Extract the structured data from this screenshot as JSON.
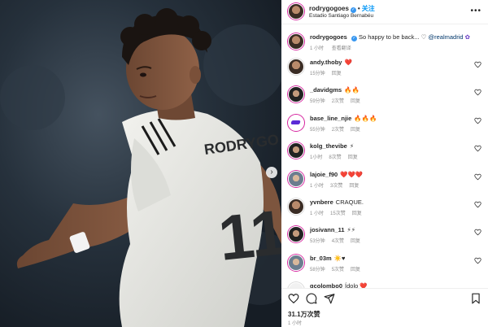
{
  "post": {
    "username": "rodrygogoes",
    "follow_label": "关注",
    "location": "Estadio Santiago Bernabéu",
    "caption_username": "rodrygogoes",
    "caption_text": "So happy to be back...",
    "caption_heart": "♡",
    "caption_mention": "@realmadrid",
    "caption_time": "1 小时",
    "caption_translate": "查看翻译",
    "jersey_number": "11",
    "jersey_name": "RODRYGO"
  },
  "comments": [
    {
      "user": "andy.thoby",
      "text": "❤️",
      "time": "15分钟",
      "likes": "",
      "reply": "回复",
      "avatar": "plain"
    },
    {
      "user": "_davidgms",
      "text": "🔥🔥",
      "time": "59分钟",
      "likes": "2次赞",
      "reply": "回复",
      "avatar": "dark"
    },
    {
      "user": "base_line_njie",
      "text": "🔥🔥🔥",
      "time": "55分钟",
      "likes": "2次赞",
      "reply": "回复",
      "avatar": "logo"
    },
    {
      "user": "kolg_thevibe",
      "text": "⚡",
      "time": "1小时",
      "likes": "8次赞",
      "reply": "回复",
      "avatar": "dark"
    },
    {
      "user": "lajoie_f90",
      "text": "❤️❤️❤️",
      "time": "1 小时",
      "likes": "3次赞",
      "reply": "回复",
      "avatar": "light"
    },
    {
      "user": "yvnbere",
      "text": "CRAQUE.",
      "time": "1 小时",
      "likes": "15次赞",
      "reply": "回复",
      "avatar": "plain"
    },
    {
      "user": "josivann_11",
      "text": "⚡⚡",
      "time": "53分钟",
      "likes": "4次赞",
      "reply": "回复",
      "avatar": "dark"
    },
    {
      "user": "br_03m",
      "text": "☀️♥",
      "time": "58分钟",
      "likes": "5次赞",
      "reply": "回复",
      "avatar": "light"
    },
    {
      "user": "gcolombo0",
      "text": "Ídolo ❤️",
      "time": "",
      "likes": "",
      "reply": "",
      "avatar": "blank"
    }
  ],
  "footer": {
    "likes": "31.1万次赞",
    "time": "1 小时"
  },
  "icons": [
    "heart-icon",
    "comment-icon",
    "share-icon",
    "bookmark-icon",
    "more-icon",
    "verified-icon",
    "next-arrow-icon"
  ],
  "colors": {
    "link": "#0095f6",
    "verified": "#3897f0",
    "muted": "#8e8e8e",
    "like_red": "#ed4956"
  }
}
